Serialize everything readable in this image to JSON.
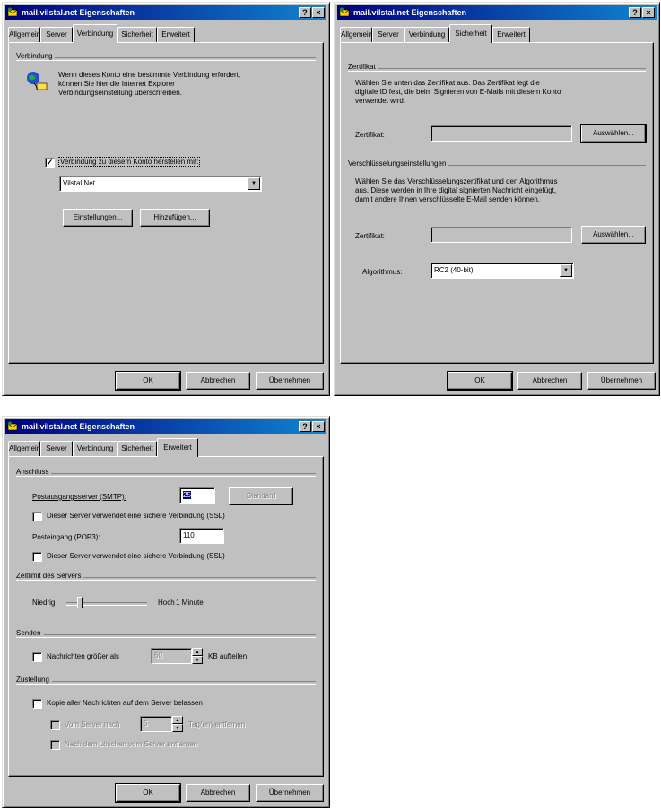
{
  "windows": [
    {
      "title": "mail.vilstal.net Eigenschaften",
      "tabs": [
        "Allgemein",
        "Server",
        "Verbindung",
        "Sicherheit",
        "Erweitert"
      ],
      "active_tab": "Verbindung",
      "help_label": "?",
      "close_label": "×",
      "group_label": "Verbindung",
      "description": [
        "Wenn dieses Konto eine bestimmte Verbindung erfordert,",
        "können Sie hier die Internet Explorer",
        "Verbindungseinstellung überschreiben."
      ],
      "checkbox_label": "Verbindung zu diesem Konto herstellen mit:",
      "checkbox_checked": "✓",
      "connection_value": "Vilstal.Net",
      "settings_button": "Einstellungen...",
      "add_button": "Hinzufügen...",
      "ok": "OK",
      "cancel": "Abbrechen",
      "apply": "Übernehmen"
    },
    {
      "title": "mail.vilstal.net Eigenschaften",
      "tabs": [
        "Allgemein",
        "Server",
        "Verbindung",
        "Sicherheit",
        "Erweitert"
      ],
      "active_tab": "Sicherheit",
      "help_label": "?",
      "close_label": "×",
      "cert_group": "Zertifikat",
      "cert_desc": [
        "Wählen Sie unten das Zertifikat aus. Das Zertifikat legt die",
        "digitale ID fest, die beim Signieren von E-Mails mit diesem Konto",
        "verwendet wird."
      ],
      "cert_label": "Zertifikat:",
      "cert_button": "Auswählen...",
      "enc_group": "Verschlüsselungseinstellungen",
      "enc_desc": [
        "Wählen Sie das Verschlüsselungszertifikat und den Algorithmus",
        "aus. Diese werden in Ihre digital signierten Nachricht eingefügt,",
        "damit andere Ihnen verschlüsselte E-Mail senden können."
      ],
      "enc_cert_label": "Zertifikat:",
      "enc_cert_button": "Auswählen...",
      "algo_label": "Algorithmus:",
      "algo_value": "RC2 (40-bit)",
      "ok": "OK",
      "cancel": "Abbrechen",
      "apply": "Übernehmen"
    },
    {
      "title": "mail.vilstal.net Eigenschaften",
      "tabs": [
        "Allgemein",
        "Server",
        "Verbindung",
        "Sicherheit",
        "Erweitert"
      ],
      "active_tab": "Erweitert",
      "help_label": "?",
      "close_label": "×",
      "ports_group": "Anschluss",
      "smtp_label": "Postausgangsserver (SMTP):",
      "smtp_value": "25",
      "default_button": "Standard",
      "ssl1_label": "Dieser Server verwendet eine sichere Verbindung (SSL)",
      "pop3_label": "Posteingang (POP3):",
      "pop3_value": "110",
      "ssl2_label": "Dieser Server verwendet eine sichere Verbindung (SSL)",
      "timeout_group": "Zeitlimit des Servers",
      "timeout_low": "Niedrig",
      "timeout_high": "Hoch",
      "timeout_value": "1 Minute",
      "send_group": "Senden",
      "split_label": "Nachrichten größer als",
      "split_value": "60",
      "split_unit": "KB aufteilen",
      "delivery_group": "Zustellung",
      "keep_label": "Kopie aller Nachrichten auf dem Server belassen",
      "remove_after_label": "Vom Server nach",
      "remove_after_value": "5",
      "remove_after_unit": "Tag(en) entfernen",
      "remove_deleted_label": "Nach dem Löschen vom Server entfernen",
      "ok": "OK",
      "cancel": "Abbrechen",
      "apply": "Übernehmen"
    }
  ]
}
